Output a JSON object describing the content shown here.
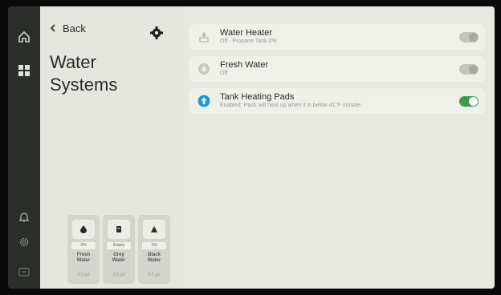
{
  "nav": {
    "back_label": "Back"
  },
  "panel": {
    "title_line1": "Water",
    "title_line2": "Systems"
  },
  "tanks": [
    {
      "level": "2%",
      "name_line1": "Fresh",
      "name_line2": "Water",
      "gallons": "0.0 gal"
    },
    {
      "level": "Empty",
      "name_line1": "Grey",
      "name_line2": "Water",
      "gallons": "0.0 gal"
    },
    {
      "level": "1%",
      "name_line1": "Black",
      "name_line2": "Water",
      "gallons": "0.0 gal"
    }
  ],
  "rows": [
    {
      "title": "Water Heater",
      "subtitle": "Off · Propane Tank 0%",
      "enabled": false,
      "icon": "water-heater-icon"
    },
    {
      "title": "Fresh Water",
      "subtitle": "Off",
      "enabled": false,
      "icon": "water-drop-icon"
    },
    {
      "title": "Tank Heating Pads",
      "subtitle": "Enabled: Pads will heat up when it is below 41°F outside",
      "enabled": true,
      "icon": "arrow-up-circle-icon"
    }
  ],
  "colors": {
    "accent_blue": "#1e9ad6",
    "toggle_on": "#3f9a4a",
    "rail_bg": "#2c2e2c",
    "panel_bg": "#e6e6e0"
  }
}
